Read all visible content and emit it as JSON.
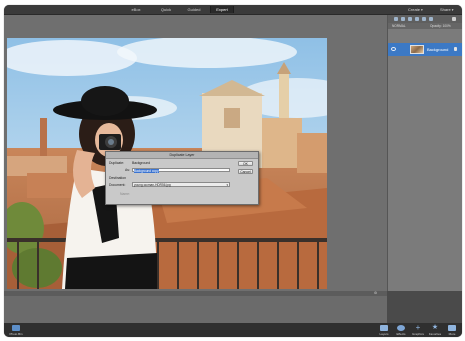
{
  "mode_tabs": {
    "ebox": "eBox",
    "quick": "Quick",
    "guided": "Guided",
    "expert": "Expert"
  },
  "top_right": {
    "create": "Create",
    "share": "Share"
  },
  "dialog": {
    "title": "Duplicate Layer",
    "duplicate_label": "Duplicate:",
    "duplicate_value": "Background",
    "as_label": "As:",
    "as_value": "Background copy",
    "destination_label": "Destination",
    "document_label": "Document:",
    "document_value": "young-woman-HDR56.jpg",
    "name_label": "Name:",
    "ok_label": "OK",
    "cancel_label": "Cancel"
  },
  "right_panel": {
    "options_text": "NORMAL",
    "opacity_text": "Opacity: 100%",
    "layer_name": "Background"
  },
  "bottom_bar": {
    "photo_bin_label": "Photo Bin",
    "layers_label": "Layers",
    "effects_label": "Effects",
    "graphics_label": "Graphics",
    "favorites_label": "Favorites",
    "more_label": "More"
  },
  "colors": {
    "accent": "#3c79c5",
    "chrome_dark": "#2f2f2f",
    "workspace": "#6f6f6f"
  }
}
